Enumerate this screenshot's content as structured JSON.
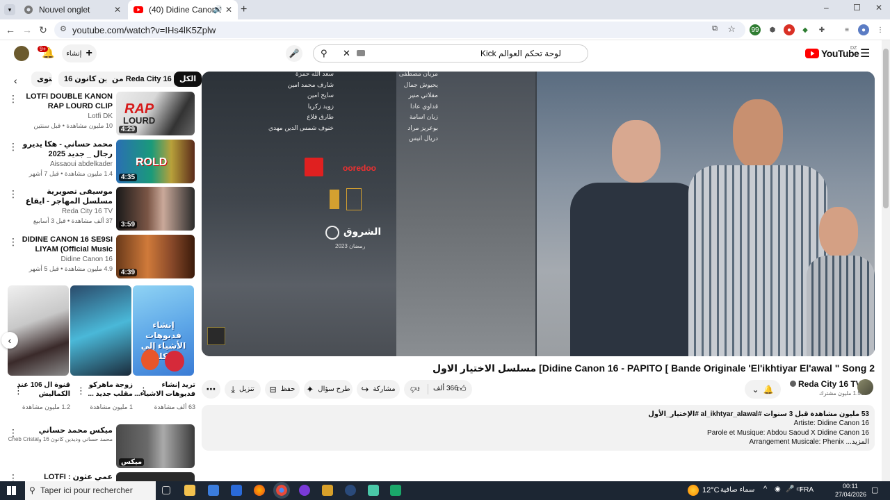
{
  "browser": {
    "tabs": [
      {
        "title": "Nouvel onglet"
      },
      {
        "title": "(40) Didine Canon 16 - PAPIT"
      }
    ],
    "url": "youtube.com/watch?v=IHs4lK5Zplw"
  },
  "yt": {
    "logo_text": "YouTube",
    "region": "DZ",
    "search_value": "لوحة تحكم العوالم Kick",
    "create_label": "إنشاء",
    "notif_badge": "9+"
  },
  "chips": [
    "الكل",
    "من Reda City 16 TV",
    "ديدين كانون 16",
    "محتوى"
  ],
  "related": [
    {
      "title": "LOTFI DOUBLE KANON RAP LOURD CLIP OFFICIEL ( All ...",
      "channel": "Lotfi DK",
      "meta": "10 مليون مشاهدة • قبل سنتين",
      "duration": "4:29"
    },
    {
      "title": "محمد حساني - هكا يديرو رجال _ جديد 2025",
      "channel": "Aissaoui abdelkader",
      "meta": "1.4 مليون مشاهدة • قبل 7 أشهر",
      "duration": "4:35"
    },
    {
      "title": "موسيقى تصويرية مسلسل المهاجر - ايقاع الهوى",
      "channel": "Reda City 16 TV",
      "meta": "37 ألف مشاهدة • قبل 3 أسابيع",
      "duration": "3:59"
    },
    {
      "title": "DIDINE CANON 16 SE9SI LIYAM (Official Music Video)",
      "channel": "Didine Canon 16",
      "meta": "4.9 مليون مشاهدة • قبل 5 أشهر",
      "duration": "4:39"
    }
  ],
  "shorts": [
    {
      "title": "تريد إنشاء فديوهات الاشياء...",
      "views": "63 ألف مشاهدة",
      "overlay": "إنشاء فديوهات الأشياء إلي تتكلم"
    },
    {
      "title": "زوجة ماهركو مقلب جديد ...",
      "views": "1 مليون مشاهدة"
    },
    {
      "title": "قنوة ال 106 عند الكماليش",
      "views": "1.2 مليون مشاهدة"
    }
  ],
  "mix": {
    "title": "ميكس محمد حساني",
    "sub": "محمد حساني وديدين كانون 16 وCheb Cristal وآخرون",
    "badge": "ميكس"
  },
  "next": {
    "title": "عمي عثون : LOTFI DOUBLE KANON"
  },
  "video": {
    "title": "مسلسل الاختيار الاول [Didine Canon 16 - PAPITO [ Bande Originale 'El'ikhtiyar El'awal \" Song 2",
    "channel": "Reda City 16 TV",
    "subs": "1.51 مليون مشترك",
    "likes": "366 ألف",
    "share": "مشاركة",
    "ask": "طرح سؤال",
    "save": "حفظ",
    "download": "تنزيل",
    "credits_right": [
      "سعد الله حمزة",
      "شارف محمد امين",
      "سايح امين",
      "زويد زكريا",
      "طارق قلاع",
      "خنوف شمس الدين مهدي"
    ],
    "credits_left": [
      "مريان مصطفى",
      "يحيوش جمال",
      "مقلاتي منير",
      "قداوي عادا",
      "زيان اسامة",
      "بوعريز مراد",
      "دريال انيس"
    ],
    "sponsor1": "ooredoo",
    "tv": "الشروق",
    "ramadan": "رمضان 2023",
    "desc_stats": "53 مليون مشاهدة  قبل 3 سنوات  #al_ikhtyar_alawal #الإختيار_الأول",
    "desc_line1": "Artiste: Didine Canon 16",
    "desc_line2": "Parole et Musique: Abdou Saoud X Didine Canon 16",
    "desc_line3": "Arrangement Musicale: Phenix ...المزيد"
  },
  "taskbar": {
    "search_placeholder": "Taper ici pour rechercher",
    "temp": "12°C",
    "weather": "سماء صافية",
    "lang": "FRA",
    "time": "00:11",
    "date": "27/04/2026"
  }
}
